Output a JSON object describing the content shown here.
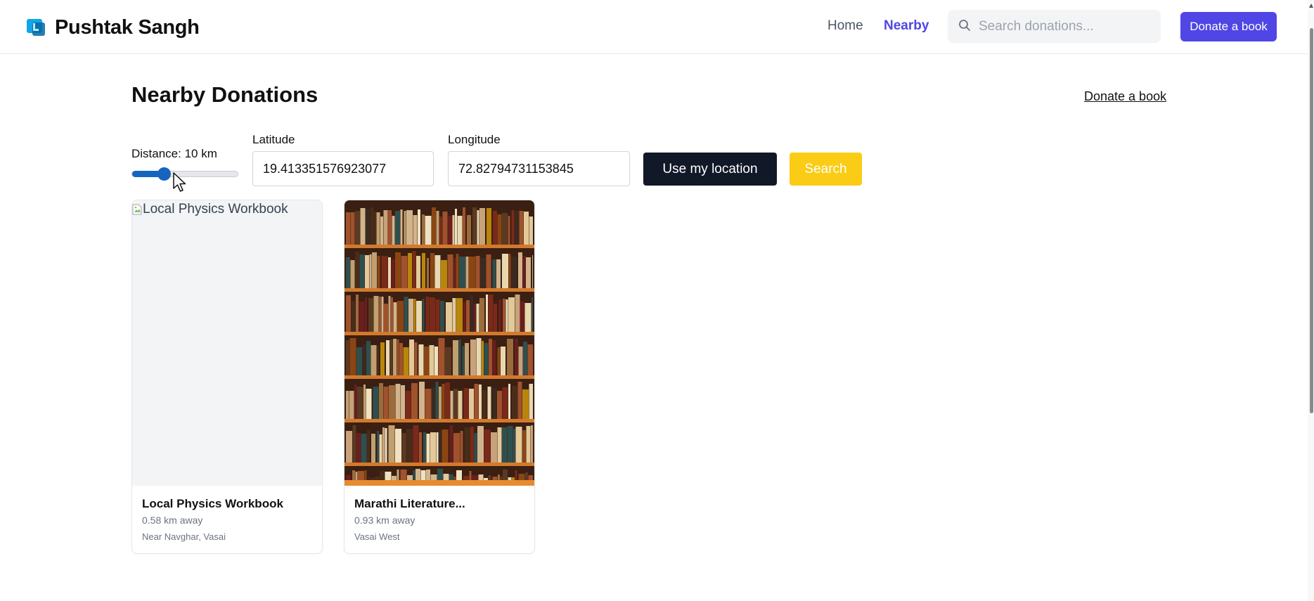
{
  "header": {
    "brand_name": "Pushtak Sangh",
    "nav": {
      "home": "Home",
      "nearby": "Nearby"
    },
    "search_placeholder": "Search donations...",
    "donate_button": "Donate a book"
  },
  "main": {
    "title": "Nearby Donations",
    "donate_link": "Donate a book",
    "filters": {
      "distance_label": "Distance: 10 km",
      "distance_km": 10,
      "latitude_label": "Latitude",
      "latitude_value": "19.413351576923077",
      "longitude_label": "Longitude",
      "longitude_value": "72.82794731153845",
      "use_location_button": "Use my location",
      "search_button": "Search"
    },
    "cards": [
      {
        "image_alt": "Local Physics Workbook",
        "title": "Local Physics Workbook",
        "distance": "0.58 km away",
        "location": "Near Navghar, Vasai"
      },
      {
        "image_alt": "",
        "title": "Marathi Literature...",
        "distance": "0.93 km away",
        "location": "Vasai West"
      }
    ]
  },
  "colors": {
    "accent": "#4f46e5",
    "dark_button": "#111827",
    "search_button": "#facc15",
    "slider": "#1565c0"
  }
}
